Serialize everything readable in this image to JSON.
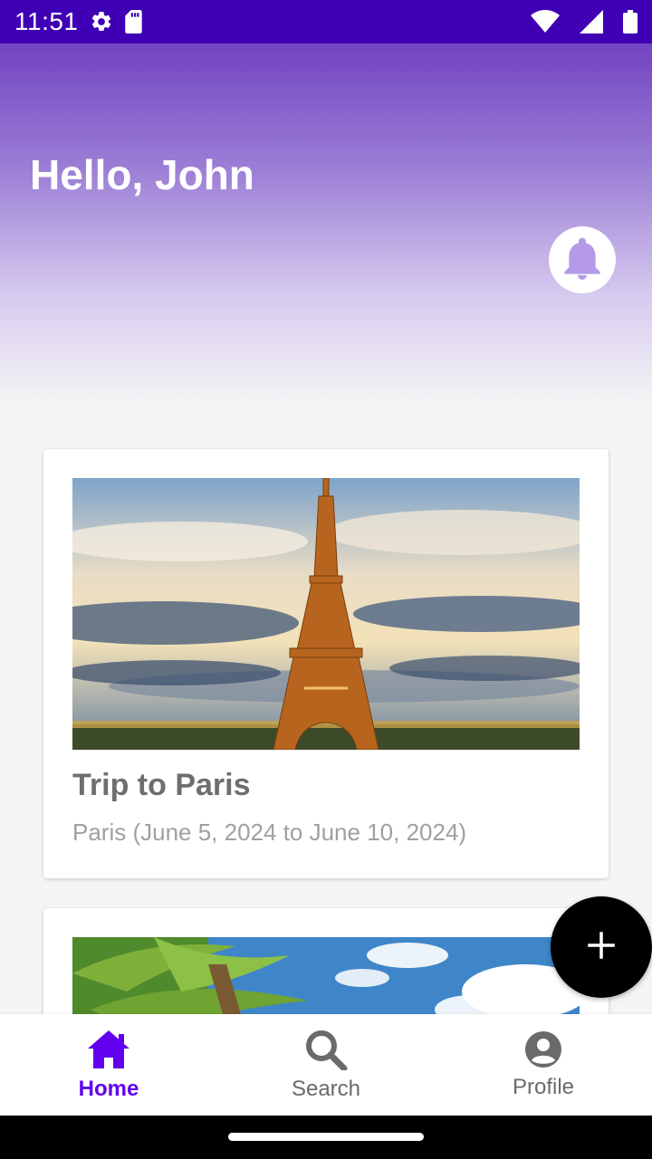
{
  "status_bar": {
    "time": "11:51",
    "left_icons": [
      "gear-icon",
      "sd-card-icon"
    ],
    "right_icons": [
      "wifi-icon",
      "signal-icon",
      "battery-icon"
    ]
  },
  "header": {
    "greeting": "Hello, John",
    "notification_icon": "bell-icon",
    "gradient_colors": [
      "#7244c1",
      "#f5f5f5"
    ]
  },
  "trips": [
    {
      "title": "Trip to Paris",
      "subtitle": "Paris (June 5, 2024 to June 10, 2024)",
      "image": "eiffel-tower-photo"
    },
    {
      "title": "",
      "subtitle": "",
      "image": "palm-beach-photo"
    }
  ],
  "fab": {
    "icon": "plus-icon"
  },
  "bottom_nav": {
    "items": [
      {
        "label": "Home",
        "icon": "home-icon",
        "active": true
      },
      {
        "label": "Search",
        "icon": "search-icon",
        "active": false
      },
      {
        "label": "Profile",
        "icon": "account-circle-icon",
        "active": false
      }
    ]
  },
  "colors": {
    "status_bar": "#3f00b5",
    "accent": "#6200ee",
    "fab": "#000000",
    "inactive_nav": "#6a6a6a"
  }
}
